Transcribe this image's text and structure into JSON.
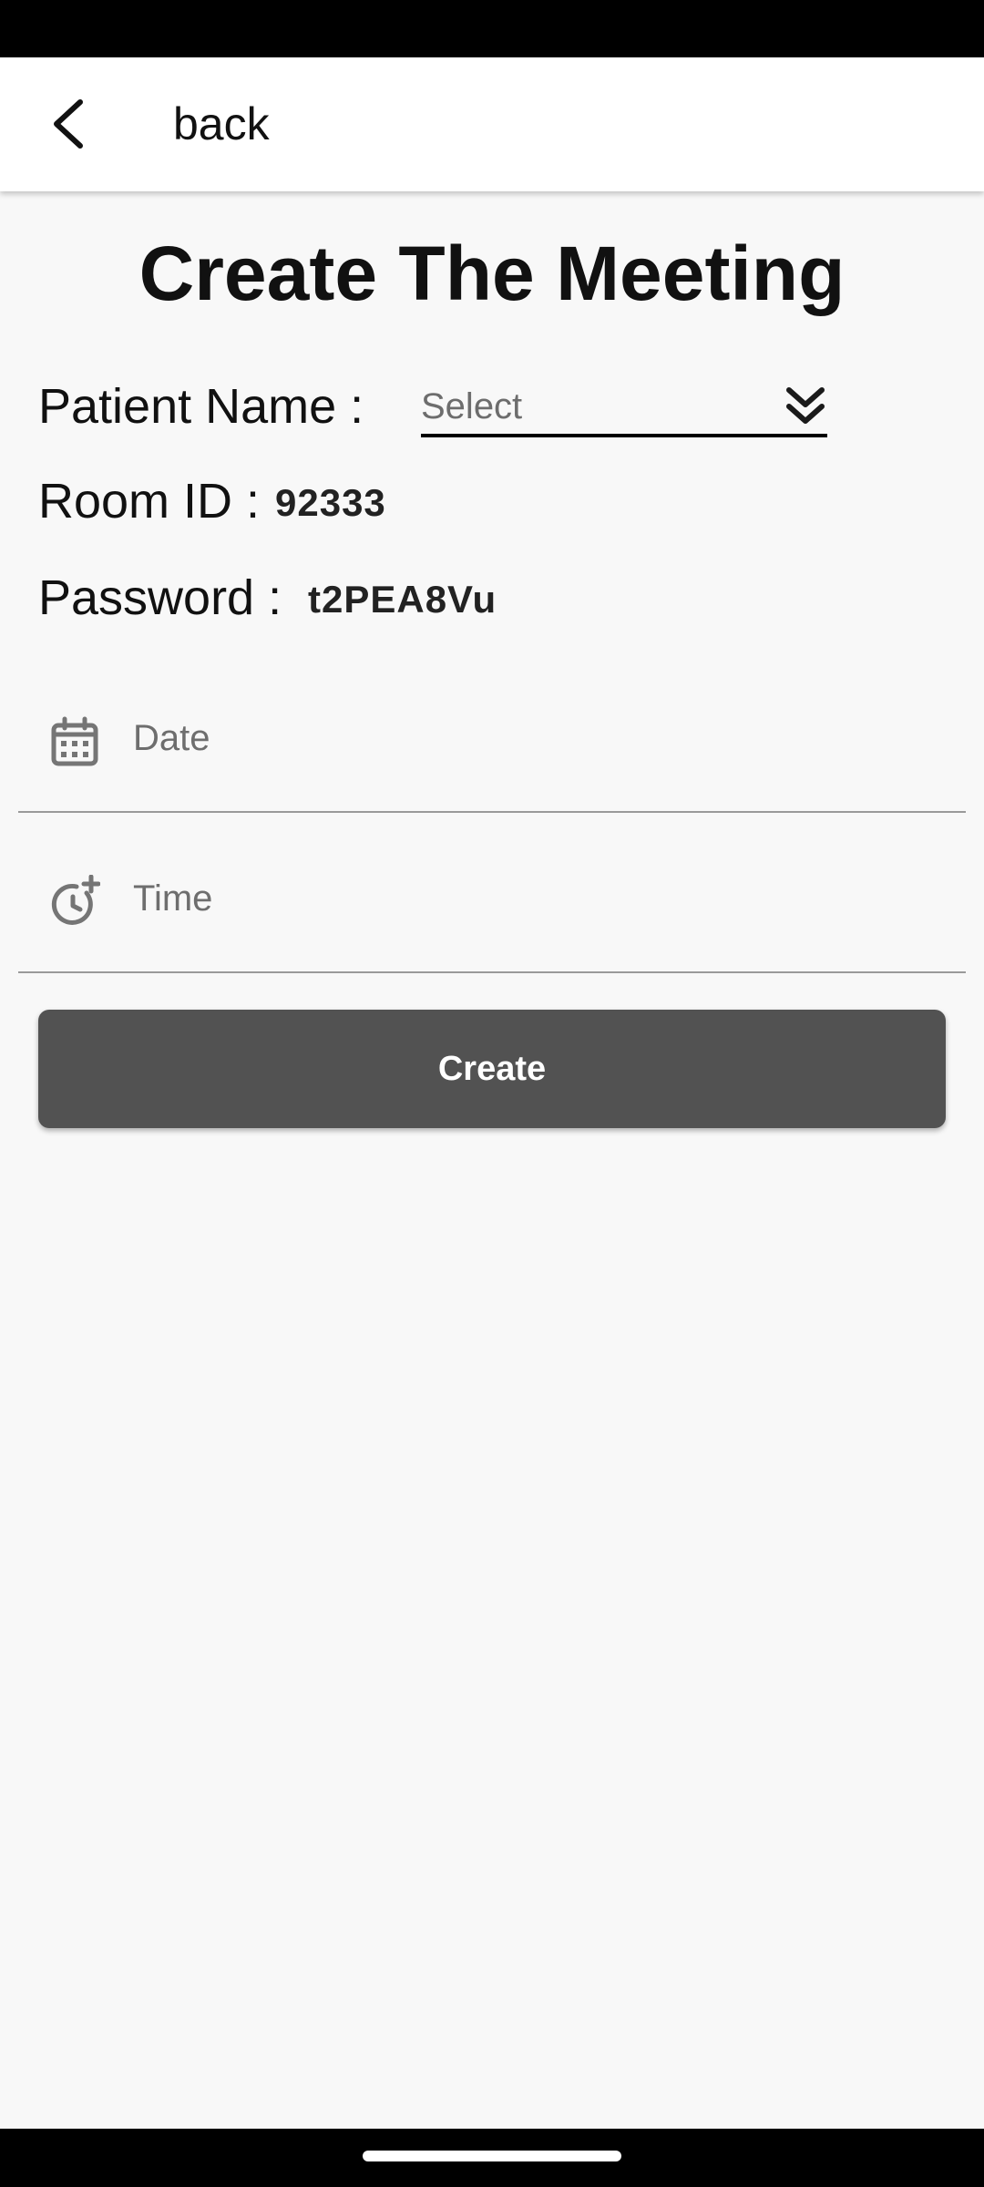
{
  "header": {
    "back_label": "back"
  },
  "page": {
    "title": "Create The Meeting"
  },
  "form": {
    "patient_name_label": "Patient Name :",
    "patient_select_value": "Select",
    "room_id_label": "Room ID :",
    "room_id_value": "92333",
    "password_label": "Password :",
    "password_value": "t2PEA8Vu",
    "date_placeholder": "Date",
    "time_placeholder": "Time",
    "create_label": "Create"
  },
  "icons": {
    "back": "chevron-left-icon",
    "select": "double-chevron-down-icon",
    "date": "calendar-icon",
    "time": "clock-add-icon"
  },
  "colors": {
    "button": "#525252",
    "background": "#f8f8f8",
    "app_bar": "#ffffff"
  }
}
